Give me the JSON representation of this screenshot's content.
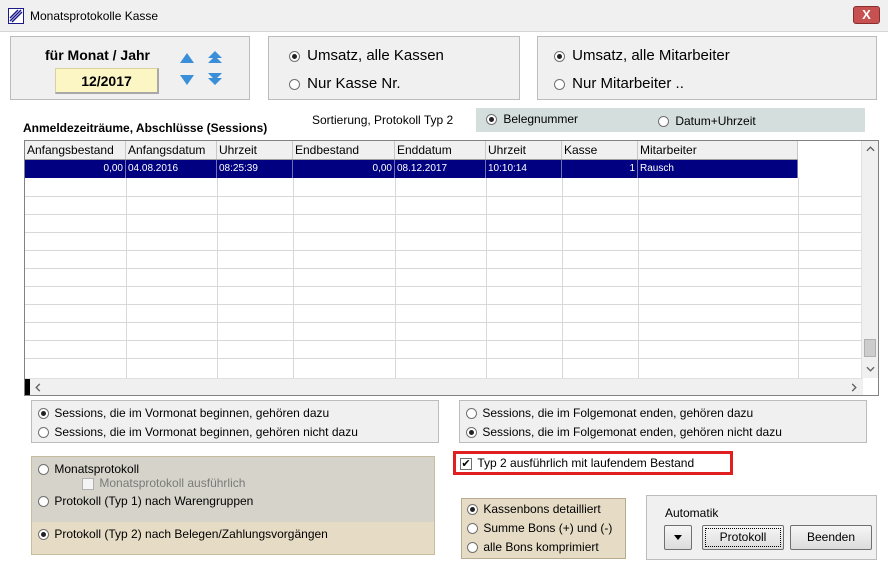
{
  "window": {
    "title": "Monatsprotokolle Kasse",
    "close_label": "X"
  },
  "month": {
    "label": "für Monat / Jahr",
    "value": "12/2017"
  },
  "kassen": {
    "opt1": "Umsatz, alle Kassen",
    "opt2": "Nur Kasse Nr."
  },
  "mitarbeiter": {
    "opt1": "Umsatz, alle Mitarbeiter",
    "opt2": "Nur Mitarbeiter .."
  },
  "sessions_title": "Anmeldezeiträume, Abschlüsse (Sessions)",
  "sort": {
    "label": "Sortierung, Protokoll Typ 2",
    "opt1": "Belegnummer",
    "opt2": "Datum+Uhrzeit"
  },
  "table": {
    "headers": [
      "Anfangsbestand",
      "Anfangsdatum",
      "Uhrzeit",
      "Endbestand",
      "Enddatum",
      "Uhrzeit",
      "Kasse",
      "Mitarbeiter"
    ],
    "rows": [
      [
        "0,00",
        "04.08.2016",
        "08:25:39",
        "0,00",
        "08.12.2017",
        "10:10:14",
        "1",
        "Rausch"
      ]
    ]
  },
  "vormonat": {
    "opt1": "Sessions, die im Vormonat beginnen, gehören dazu",
    "opt2": "Sessions, die im Vormonat beginnen, gehören nicht dazu"
  },
  "folgemonat": {
    "opt1": "Sessions, die im Folgemonat enden, gehören dazu",
    "opt2": "Sessions, die im Folgemonat enden, gehören nicht dazu"
  },
  "typ2_check": "Typ 2 ausführlich mit laufendem Bestand",
  "protokoll": {
    "opt1": "Monatsprotokoll",
    "opt1_sub": "Monatsprotokoll ausführlich",
    "opt2": "Protokoll (Typ 1) nach Warengruppen",
    "opt3": "Protokoll (Typ 2) nach Belegen/Zahlungsvorgängen"
  },
  "bons": {
    "opt1": "Kassenbons detailliert",
    "opt2": "Summe Bons (+) und (-)",
    "opt3": "alle Bons komprimiert"
  },
  "automatik": {
    "label": "Automatik",
    "protokoll_btn": "Protokoll",
    "beenden_btn": "Beenden"
  },
  "colors": {
    "selection": "#000080",
    "highlight_box": "#e02020",
    "month_bg": "#fbf6c4",
    "arrow_blue": "#3a8fd8",
    "panel_tan": "#e6dcc6"
  }
}
